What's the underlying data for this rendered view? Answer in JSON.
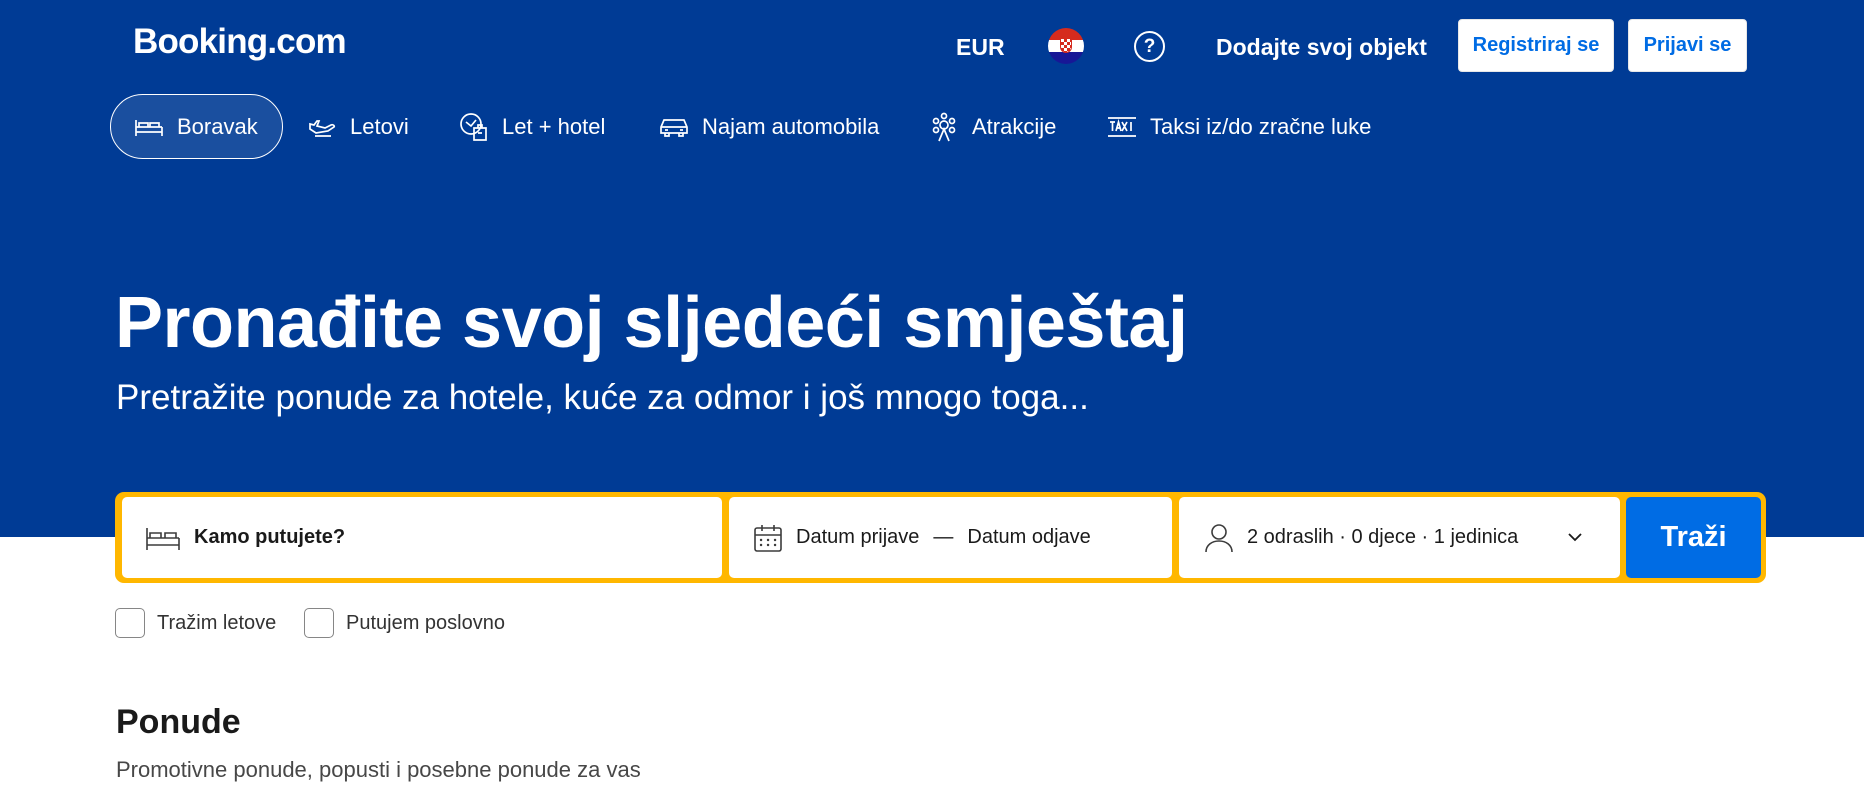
{
  "header": {
    "logo": "Booking.com",
    "currency": "EUR",
    "language_flag": "croatia-flag",
    "help_icon": "question-mark-icon",
    "help_glyph": "?",
    "add_property": "Dodajte svoj objekt",
    "register": "Registriraj se",
    "sign_in": "Prijavi se"
  },
  "nav": {
    "tabs": [
      {
        "label": "Boravak",
        "icon": "bed-icon",
        "active": true
      },
      {
        "label": "Letovi",
        "icon": "plane-icon",
        "active": false
      },
      {
        "label": "Let + hotel",
        "icon": "flight-hotel-icon",
        "active": false
      },
      {
        "label": "Najam automobila",
        "icon": "car-icon",
        "active": false
      },
      {
        "label": "Atrakcije",
        "icon": "attractions-icon",
        "active": false
      },
      {
        "label": "Taksi iz/do zračne luke",
        "icon": "taxi-icon",
        "active": false
      }
    ]
  },
  "hero": {
    "title": "Pronađite svoj sljedeći smještaj",
    "subtitle": "Pretražite ponude za hotele, kuće za odmor i još mnogo toga..."
  },
  "search": {
    "destination_placeholder": "Kamo putujete?",
    "checkin_label": "Datum prijave",
    "date_separator": "—",
    "checkout_label": "Datum odjave",
    "guests_summary": "2 odraslih · 0 djece · 1 jedinica",
    "submit": "Traži"
  },
  "options": {
    "flights_checkbox": "Tražim letove",
    "business_checkbox": "Putujem poslovno"
  },
  "offers": {
    "title": "Ponude",
    "subtitle": "Promotivne ponude, popusti i posebne ponude za vas"
  },
  "colors": {
    "brand_blue": "#003b95",
    "accent_blue": "#006ce4",
    "search_border": "#ffb700"
  }
}
